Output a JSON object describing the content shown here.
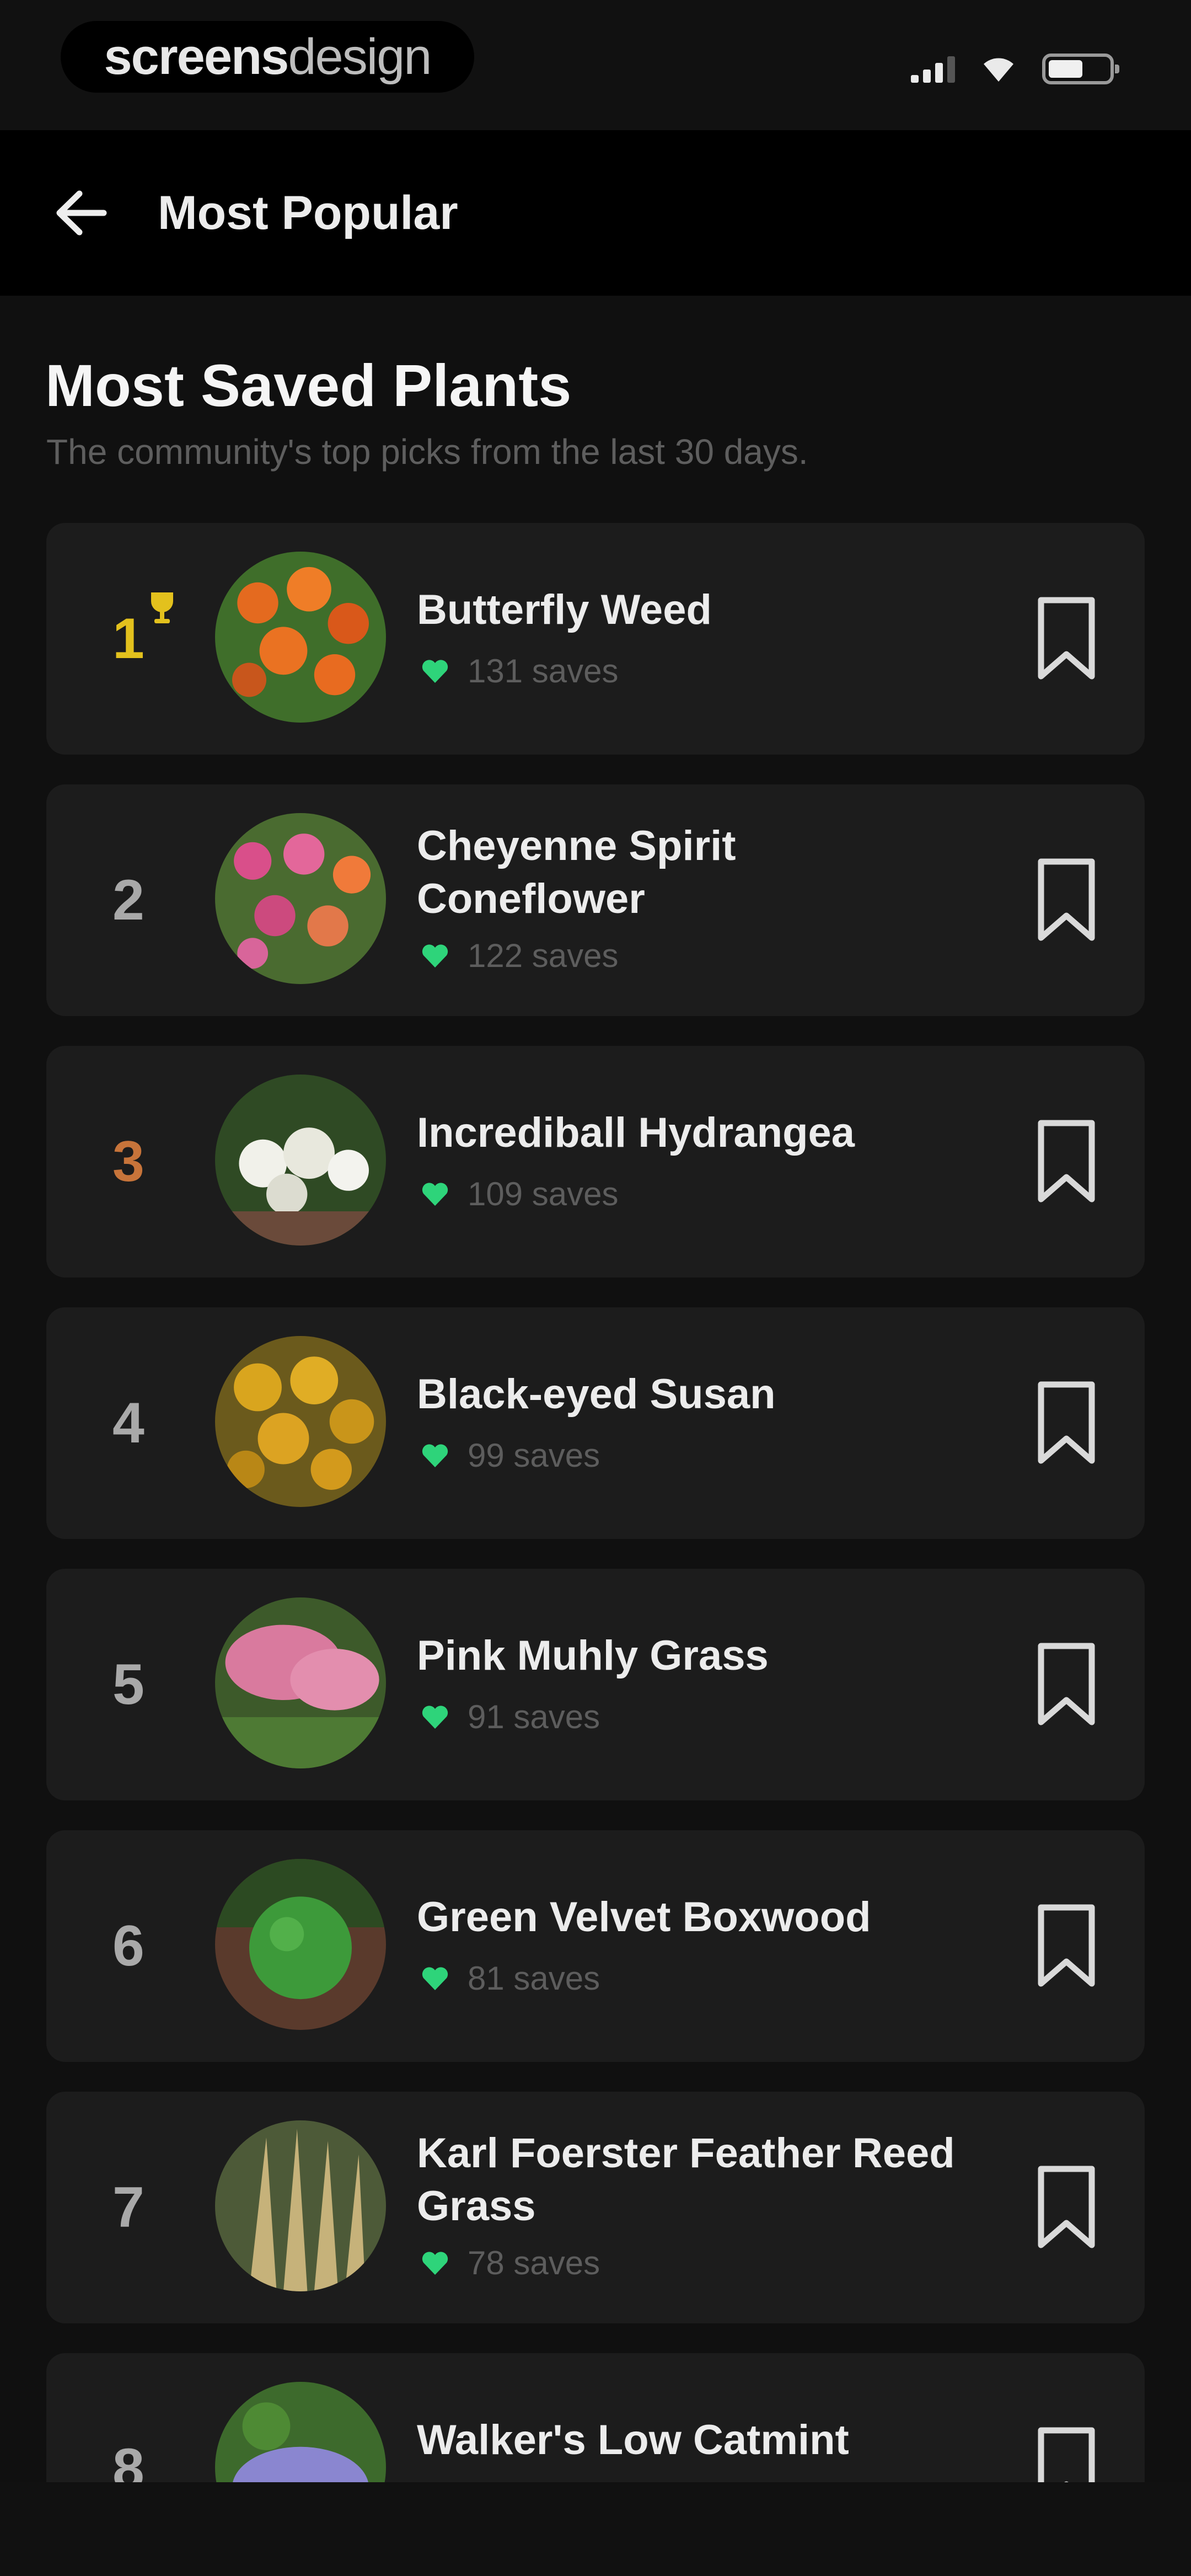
{
  "status_bar": {
    "brand_bold": "screens",
    "brand_light": "design"
  },
  "app_bar": {
    "title": "Most Popular"
  },
  "section": {
    "title": "Most Saved Plants",
    "subtitle": "The community's top picks from the last 30 days."
  },
  "colors": {
    "gold": "#e3c11d",
    "bronze": "#c7743a",
    "heart": "#2ed47a",
    "card": "#1c1c1c"
  },
  "plants": [
    {
      "rank": "1",
      "name": "Butterfly Weed",
      "saves": "131 saves"
    },
    {
      "rank": "2",
      "name": "Cheyenne Spirit Coneflower",
      "saves": "122 saves"
    },
    {
      "rank": "3",
      "name": "Incrediball Hydrangea",
      "saves": "109 saves"
    },
    {
      "rank": "4",
      "name": "Black-eyed Susan",
      "saves": "99 saves"
    },
    {
      "rank": "5",
      "name": "Pink Muhly Grass",
      "saves": "91 saves"
    },
    {
      "rank": "6",
      "name": "Green Velvet Boxwood",
      "saves": "81 saves"
    },
    {
      "rank": "7",
      "name": "Karl Foerster Feather Reed Grass",
      "saves": "78 saves"
    },
    {
      "rank": "8",
      "name": "Walker's Low Catmint",
      "saves": ""
    }
  ]
}
